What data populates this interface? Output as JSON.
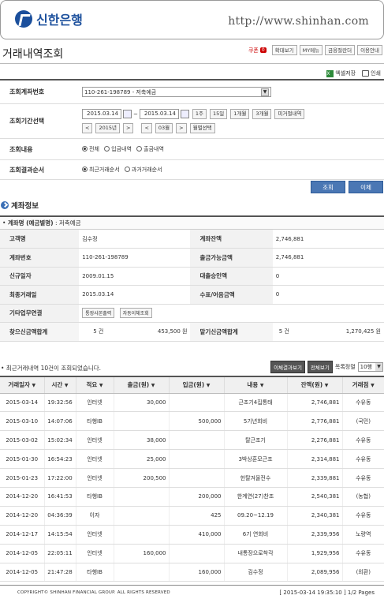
{
  "header": {
    "bank_name": "신한은행",
    "site_url": "http://www.shinhan.com"
  },
  "page": {
    "title": "거래내역조회",
    "util": {
      "coupon_label": "쿠폰",
      "coupon_count": "0",
      "zoom": "확대보기",
      "my_menu": "MY메뉴",
      "finance_dict": "금융절란더",
      "usage_guide": "이용안내"
    },
    "save_excel": "엑셀저장",
    "print": "인쇄"
  },
  "search": {
    "account_label": "조회계좌번호",
    "account_value": "110-261-198789 - 저축예금",
    "period_label": "조회기간선택",
    "date_from": "2015.03.14",
    "date_to": "2015.03.14",
    "tilde": "~",
    "quick": [
      "1주",
      "15일",
      "1개월",
      "3개월",
      "미거절내역"
    ],
    "year": "2015년",
    "month": "03월",
    "month_select": "월별선택",
    "prev": "<",
    "next": ">",
    "content_label": "조회내용",
    "content_options": [
      "전체",
      "입금내역",
      "출금내역"
    ],
    "order_label": "조회결과순서",
    "order_options": [
      "최근거래순서",
      "과거거래순서"
    ]
  },
  "actions": {
    "search": "조회",
    "transfer": "이체"
  },
  "account_info": {
    "section_title": "계좌정보",
    "name_label": "계좌명 (예금별명)",
    "name_value": "저축예금",
    "rows": [
      {
        "k1": "고객명",
        "v1": "김수정",
        "k2": "계좌잔액",
        "v2": "2,746,881"
      },
      {
        "k1": "계좌번호",
        "v1": "110-261-198789",
        "k2": "출금가능금액",
        "v2": "2,746,881"
      },
      {
        "k1": "신규일자",
        "v1": "2009.01.15",
        "k2": "대출승인액",
        "v2": "0"
      },
      {
        "k1": "최종거래일",
        "v1": "2015.03.14",
        "k2": "수표/어음금액",
        "v2": "0"
      }
    ],
    "other_label": "기타업무연결",
    "other_btn1": "통장사본출력",
    "other_btn2": "자동이체조회",
    "sum_out_label": "찾으신금액합계",
    "sum_out_count": "5 건",
    "sum_out_amount": "453,500 원",
    "sum_in_label": "맡기신금액합계",
    "sum_in_count": "5 건",
    "sum_in_amount": "1,270,425 원"
  },
  "results": {
    "note": "• 최근거래내역 10건이 조회되었습니다.",
    "btn_transfer_result": "이체결과보기",
    "btn_view_all": "전체보기",
    "rows_label": "목록정렬",
    "rows_value": "10행"
  },
  "table": {
    "headers": [
      "거래일자",
      "시간",
      "적요",
      "출금(원)",
      "입금(원)",
      "내용",
      "잔액(원)",
      "거래점"
    ],
    "rows": [
      [
        "2015-03-14",
        "19:32:56",
        "인터넷",
        "30,000",
        "",
        "근조기4집통태",
        "2,746,881",
        "수유동"
      ],
      [
        "2015-03-10",
        "14:07:06",
        "타행IB",
        "",
        "500,000",
        "5기년회비",
        "2,776,881",
        "(국민)"
      ],
      [
        "2015-03-02",
        "15:02:34",
        "인터넷",
        "38,000",
        "",
        "탈근조기",
        "2,276,881",
        "수유동"
      ],
      [
        "2015-01-30",
        "16:54:23",
        "인터넷",
        "25,000",
        "",
        "3박상훈모근조",
        "2,314,881",
        "수유동"
      ],
      [
        "2015-01-23",
        "17:22:00",
        "인터넷",
        "200,500",
        "",
        "헌탈겨울전수",
        "2,339,881",
        "수유동"
      ],
      [
        "2014-12-20",
        "16:41:53",
        "타행IB",
        "",
        "200,000",
        "한계연(27)찬조",
        "2,540,381",
        "(농협)"
      ],
      [
        "2014-12-20",
        "04:36:39",
        "이자",
        "",
        "425",
        "09.20~12.19",
        "2,340,381",
        "수유동"
      ],
      [
        "2014-12-17",
        "14:15:54",
        "인터넷",
        "",
        "410,000",
        "6기 연회비",
        "2,339,956",
        "노량역"
      ],
      [
        "2014-12-05",
        "22:05:11",
        "인터넷",
        "160,000",
        "",
        "내통장으로착각",
        "1,929,956",
        "수유동"
      ],
      [
        "2014-12-05",
        "21:47:28",
        "타행IB",
        "",
        "160,000",
        "김수정",
        "2,089,956",
        "(외환)"
      ]
    ]
  },
  "footer": {
    "copyright": "COPYRIGHT© SHINHAN FINANCIAL GROUP. ALL RIGHTS RESERVED",
    "stamp": "[ 2015-03-14 19:35:10 ] 1/2 Pages"
  },
  "colors": {
    "brand": "#1b4f9c",
    "button": "#4a77b4",
    "dark_button": "#555555"
  }
}
